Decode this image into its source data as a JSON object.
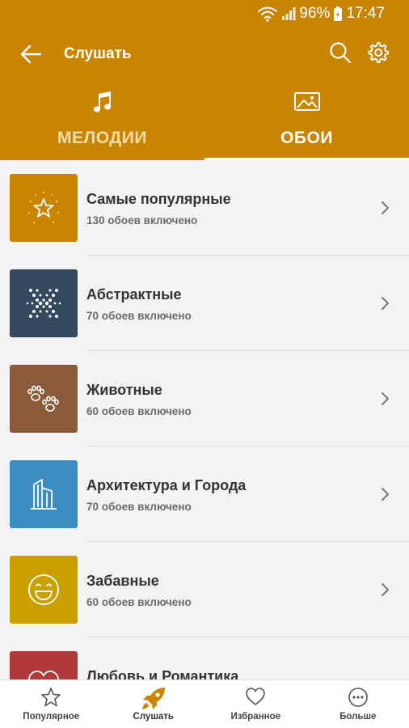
{
  "status": {
    "battery": "96%",
    "time": "17:47"
  },
  "toolbar": {
    "title": "Слушать"
  },
  "tabs": [
    {
      "label": "МЕЛОДИИ",
      "icon": "music-note-icon",
      "active": false
    },
    {
      "label": "ОБОИ",
      "icon": "image-icon",
      "active": true
    }
  ],
  "categories": [
    {
      "name": "Самые популярные",
      "count": "130 обоев включено",
      "color": "#c98400",
      "icon": "star-icon"
    },
    {
      "name": "Абстрактные",
      "count": "70 обоев включено",
      "color": "#34495e",
      "icon": "abstract-dots-icon"
    },
    {
      "name": "Животные",
      "count": "60 обоев включено",
      "color": "#8b5a3a",
      "icon": "paw-prints-icon"
    },
    {
      "name": "Архитектура и Города",
      "count": "70 обоев включено",
      "color": "#3a8ec2",
      "icon": "building-icon"
    },
    {
      "name": "Забавные",
      "count": "60 обоев включено",
      "color": "#c9a000",
      "icon": "smile-icon"
    },
    {
      "name": "Любовь и Романтика",
      "count": "",
      "color": "#b03a3a",
      "icon": "heart-icon"
    }
  ],
  "bottom_nav": [
    {
      "label": "Популярное",
      "icon": "star-outline-icon",
      "active": false
    },
    {
      "label": "Слушать",
      "icon": "rocket-icon",
      "active": true
    },
    {
      "label": "Избранное",
      "icon": "heart-outline-icon",
      "active": false
    },
    {
      "label": "Больше",
      "icon": "more-dots-icon",
      "active": false
    }
  ],
  "colors": {
    "accent": "#c98400",
    "list_background": "#f3f3f3"
  }
}
